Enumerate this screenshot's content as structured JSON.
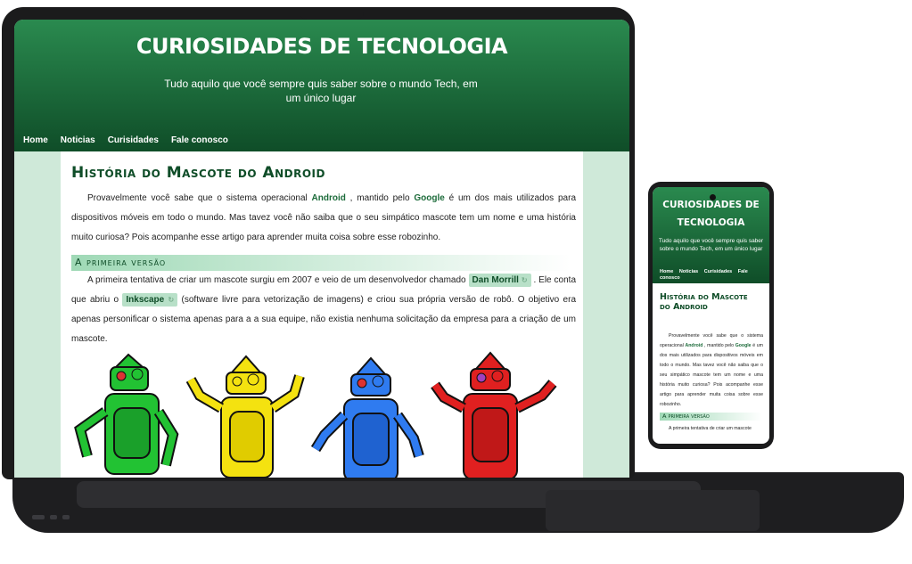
{
  "site": {
    "title": "CURIOSIDADES DE TECNOLOGIA",
    "tagline": "Tudo aquilo que você sempre quis saber sobre o mundo Tech, em um único lugar",
    "nav": [
      "Home",
      "Noticias",
      "Curisidades",
      "Fale conosco"
    ]
  },
  "article": {
    "title": "História do Mascote do Android",
    "para1": {
      "t1": "Provavelmente você sabe que o sistema operacional ",
      "kw1": "Android",
      "t2": " , mantido pelo ",
      "kw2": "Google",
      "t3": " é um dos mais utilizados para dispositivos móveis em todo o mundo. Mas tavez você não saiba que o seu simpático mascote tem um nome e uma história muito curiosa? Pois acompanhe esse artigo para aprender muita coisa sobre esse robozinho."
    },
    "section_title": "A primeira versão",
    "para2": {
      "t1": "A primeira tentativa de criar um mascote surgiu em 2007 e veio de um desenvolvedor chamado ",
      "chip1": "Dan Morrill",
      "t2": " . Ele conta que abriu o ",
      "chip2": "Inkscape",
      "t3": " (software livre para vetorização de imagens) e criou sua própria versão de robô. O objetivo era apenas personificar o sistema apenas para a a sua equipe, não existia nenhuma solicitação da empresa para a criação de um mascote."
    },
    "link_icon": "external-link-icon",
    "robot_colors": [
      "#22c233",
      "#f4e210",
      "#2f7bf0",
      "#e02020"
    ]
  },
  "phone": {
    "title": "CURIOSIDADES DE TECNOLOGIA",
    "tagline": "Tudo aquilo que você sempre quis saber sobre o mundo Tech, em um único lugar",
    "nav": [
      "Home",
      "Noticias",
      "Curisidades",
      "Fale conosco"
    ],
    "article_title": "História do Mascote do Android",
    "para1": {
      "t1": "Provavelmente você sabe que o sistema operacional ",
      "kw1": "Android",
      "t2": " , mantido pelo ",
      "kw2": "Google",
      "t3": " é um dos mais utilizados para dispositivos móveis em todo o mundo. Mas tavez você não saiba que o seu simpático mascote tem um nome e uma história muito curiosa? Pois acompanhe esse artigo para aprender muita coisa sobre esse robozinho."
    },
    "section_title": "A primeira versão",
    "para2": "A primeira tentativa de criar um mascote"
  },
  "colors": {
    "header_top": "#2a8a4f",
    "header_bottom": "#0f4d28",
    "accent_light": "#b8e0c8",
    "page_bg": "#cfe9d9"
  }
}
